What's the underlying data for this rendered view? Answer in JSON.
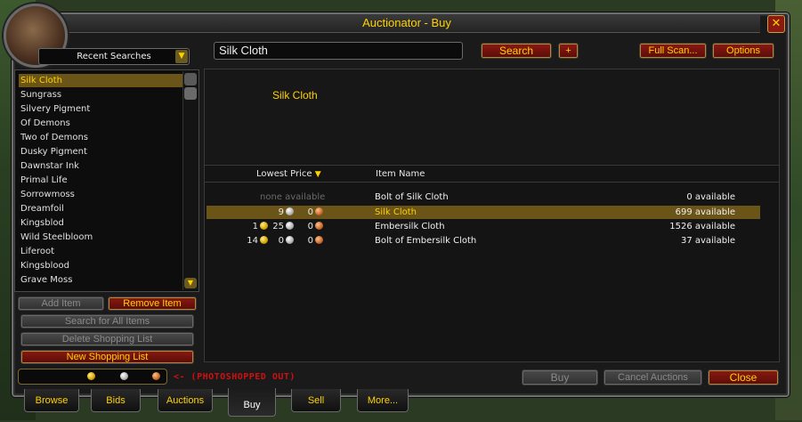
{
  "window": {
    "title": "Auctionator - Buy",
    "close_glyph": "✕"
  },
  "sidebar": {
    "dropdown_label": "Recent Searches",
    "items": [
      {
        "label": "Silk Cloth",
        "selected": true
      },
      {
        "label": "Sungrass"
      },
      {
        "label": "Silvery Pigment"
      },
      {
        "label": "Of Demons"
      },
      {
        "label": "Two of Demons"
      },
      {
        "label": "Dusky Pigment"
      },
      {
        "label": "Dawnstar Ink"
      },
      {
        "label": "Primal Life"
      },
      {
        "label": "Sorrowmoss"
      },
      {
        "label": "Dreamfoil"
      },
      {
        "label": "Kingsblod"
      },
      {
        "label": "Wild Steelbloom"
      },
      {
        "label": "Liferoot"
      },
      {
        "label": "Kingsblood"
      },
      {
        "label": "Grave Moss"
      }
    ],
    "add_item": "Add Item",
    "remove_item": "Remove Item",
    "search_all": "Search for All Items",
    "delete_list": "Delete Shopping List",
    "new_list": "New Shopping List"
  },
  "search": {
    "value": "Silk Cloth",
    "button": "Search",
    "plus": "+",
    "full_scan": "Full Scan...",
    "options": "Options"
  },
  "info": {
    "title": "Silk Cloth"
  },
  "table": {
    "col_price": "Lowest Price",
    "col_name": "Item Name",
    "rows": [
      {
        "none": "none available",
        "gold": "",
        "silver": "",
        "copper": "",
        "name": "Bolt of Silk Cloth",
        "available": "0 available"
      },
      {
        "none": "",
        "gold": "",
        "silver": "9",
        "copper": "0",
        "name": "Silk Cloth",
        "available": "699 available",
        "selected": true
      },
      {
        "none": "",
        "gold": "1",
        "silver": "25",
        "copper": "0",
        "name": "Embersilk Cloth",
        "available": "1526 available"
      },
      {
        "none": "",
        "gold": "14",
        "silver": "0",
        "copper": "0",
        "name": "Bolt of Embersilk Cloth",
        "available": "37 available"
      }
    ]
  },
  "bottom": {
    "note": "<- (PHOTOSHOPPED OUT)",
    "buy": "Buy",
    "cancel": "Cancel Auctions",
    "close": "Close"
  },
  "tabs": [
    "Browse",
    "Bids",
    "Auctions",
    "Buy",
    "Sell",
    "More..."
  ],
  "active_tab": "Buy",
  "colors": {
    "accent_gold": "#ffd100",
    "button_red": "#8a1a12",
    "selection": "#6a5418"
  }
}
